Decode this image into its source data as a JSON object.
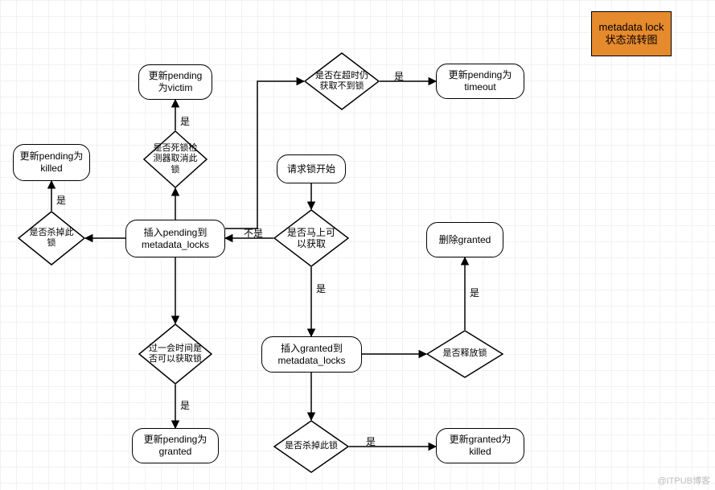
{
  "title": "metadata lock状态流转图",
  "watermark": "@ITPUB博客",
  "nodes": {
    "start": "请求锁开始",
    "canGetNow": "是否马上可以获取",
    "insertPending": "插入pending到metadata_locks",
    "insertGranted": "插入granted到metadata_locks",
    "deadlockCancel": "是否死锁检测器取消此锁",
    "updateVictim": "更新pending为victim",
    "timeoutCheck": "是否在超时仍获取不到锁",
    "updateTimeout": "更新pending为timeout",
    "killedCheck1": "是否杀掉此锁",
    "updateKilled": "更新pending为killed",
    "waitCanGet": "过一会时间是否可以获取锁",
    "updateGranted": "更新pending为granted",
    "releaseCheck": "是否释放锁",
    "deleteGranted": "删除granted",
    "killedCheck2": "是否杀掉此锁",
    "updateGrantedKilled": "更新granted为killed"
  },
  "edgeLabels": {
    "yes1": "是",
    "yes2": "是",
    "yes3": "是",
    "yes4": "是",
    "yes5": "是",
    "yes6": "是",
    "yes7": "是",
    "yes8": "是",
    "no1": "不是"
  },
  "chart_data": {
    "type": "flowchart",
    "title": "metadata lock状态流转图",
    "nodes": [
      {
        "id": "start",
        "kind": "terminator",
        "label": "请求锁开始"
      },
      {
        "id": "canGetNow",
        "kind": "decision",
        "label": "是否马上可以获取"
      },
      {
        "id": "insertPending",
        "kind": "process",
        "label": "插入pending到metadata_locks"
      },
      {
        "id": "insertGranted",
        "kind": "process",
        "label": "插入granted到metadata_locks"
      },
      {
        "id": "deadlockCancel",
        "kind": "decision",
        "label": "是否死锁检测器取消此锁"
      },
      {
        "id": "updateVictim",
        "kind": "process",
        "label": "更新pending为victim"
      },
      {
        "id": "timeoutCheck",
        "kind": "decision",
        "label": "是否在超时仍获取不到锁"
      },
      {
        "id": "updateTimeout",
        "kind": "process",
        "label": "更新pending为timeout"
      },
      {
        "id": "killedCheck1",
        "kind": "decision",
        "label": "是否杀掉此锁"
      },
      {
        "id": "updateKilled",
        "kind": "process",
        "label": "更新pending为killed"
      },
      {
        "id": "waitCanGet",
        "kind": "decision",
        "label": "过一会时间是否可以获取锁"
      },
      {
        "id": "updateGranted",
        "kind": "process",
        "label": "更新pending为granted"
      },
      {
        "id": "releaseCheck",
        "kind": "decision",
        "label": "是否释放锁"
      },
      {
        "id": "deleteGranted",
        "kind": "process",
        "label": "删除granted"
      },
      {
        "id": "killedCheck2",
        "kind": "decision",
        "label": "是否杀掉此锁"
      },
      {
        "id": "updateGrantedKilled",
        "kind": "process",
        "label": "更新granted为killed"
      }
    ],
    "edges": [
      {
        "from": "start",
        "to": "canGetNow",
        "label": ""
      },
      {
        "from": "canGetNow",
        "to": "insertPending",
        "label": "不是"
      },
      {
        "from": "canGetNow",
        "to": "insertGranted",
        "label": "是"
      },
      {
        "from": "insertPending",
        "to": "deadlockCancel",
        "label": ""
      },
      {
        "from": "deadlockCancel",
        "to": "updateVictim",
        "label": "是"
      },
      {
        "from": "insertPending",
        "to": "timeoutCheck",
        "label": ""
      },
      {
        "from": "timeoutCheck",
        "to": "updateTimeout",
        "label": "是"
      },
      {
        "from": "insertPending",
        "to": "killedCheck1",
        "label": ""
      },
      {
        "from": "killedCheck1",
        "to": "updateKilled",
        "label": "是"
      },
      {
        "from": "insertPending",
        "to": "waitCanGet",
        "label": ""
      },
      {
        "from": "waitCanGet",
        "to": "updateGranted",
        "label": "是"
      },
      {
        "from": "insertGranted",
        "to": "releaseCheck",
        "label": ""
      },
      {
        "from": "releaseCheck",
        "to": "deleteGranted",
        "label": "是"
      },
      {
        "from": "insertGranted",
        "to": "killedCheck2",
        "label": ""
      },
      {
        "from": "killedCheck2",
        "to": "updateGrantedKilled",
        "label": "是"
      }
    ]
  }
}
